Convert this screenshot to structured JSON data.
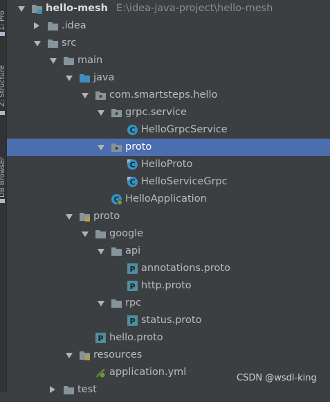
{
  "side_tabs": [
    "1: Pro",
    "Z: Structure",
    "DB Browser"
  ],
  "tree": [
    {
      "label": "hello-mesh",
      "path": "E:\\idea-java-project\\hello-mesh",
      "icon": "module-icon",
      "expanded": true,
      "depth": 0
    },
    {
      "label": ".idea",
      "icon": "folder-icon",
      "expanded": false,
      "depth": 1
    },
    {
      "label": "src",
      "icon": "folder-icon",
      "expanded": true,
      "depth": 1
    },
    {
      "label": "main",
      "icon": "folder-icon",
      "expanded": true,
      "depth": 2
    },
    {
      "label": "java",
      "icon": "source-folder-icon",
      "expanded": true,
      "depth": 3
    },
    {
      "label": "com.smartsteps.hello",
      "icon": "package-icon",
      "expanded": true,
      "depth": 4
    },
    {
      "label": "grpc.service",
      "icon": "package-icon",
      "expanded": true,
      "depth": 5
    },
    {
      "label": "HelloGrpcService",
      "icon": "class-icon",
      "depth": 6
    },
    {
      "label": "proto",
      "icon": "package-icon",
      "expanded": true,
      "depth": 5,
      "selected": true
    },
    {
      "label": "HelloProto",
      "icon": "generated-class-icon",
      "depth": 6
    },
    {
      "label": "HelloServiceGrpc",
      "icon": "generated-class-icon",
      "depth": 6
    },
    {
      "label": "HelloApplication",
      "icon": "spring-boot-class-icon",
      "depth": 5
    },
    {
      "label": "proto",
      "icon": "resources-folder-icon",
      "expanded": true,
      "depth": 3
    },
    {
      "label": "google",
      "icon": "folder-icon",
      "expanded": true,
      "depth": 4
    },
    {
      "label": "api",
      "icon": "folder-icon",
      "expanded": true,
      "depth": 5
    },
    {
      "label": "annotations.proto",
      "icon": "proto-file-icon",
      "depth": 6
    },
    {
      "label": "http.proto",
      "icon": "proto-file-icon",
      "depth": 6
    },
    {
      "label": "rpc",
      "icon": "folder-icon",
      "expanded": true,
      "depth": 5
    },
    {
      "label": "status.proto",
      "icon": "proto-file-icon",
      "depth": 6
    },
    {
      "label": "hello.proto",
      "icon": "proto-file-icon",
      "depth": 4
    },
    {
      "label": "resources",
      "icon": "resources-folder-icon",
      "expanded": true,
      "depth": 3
    },
    {
      "label": "application.yml",
      "icon": "yaml-file-icon",
      "depth": 4
    },
    {
      "label": "test",
      "icon": "folder-icon",
      "expanded": false,
      "depth": 2
    }
  ],
  "watermark": "CSDN @wsdl-king",
  "colors": {
    "background": "#3c3f41",
    "selection": "#4b6eaf",
    "folder": "#87939a",
    "source_folder": "#3d8fbf",
    "class": "#3592c4",
    "proto_file": "#4e8f9d"
  }
}
